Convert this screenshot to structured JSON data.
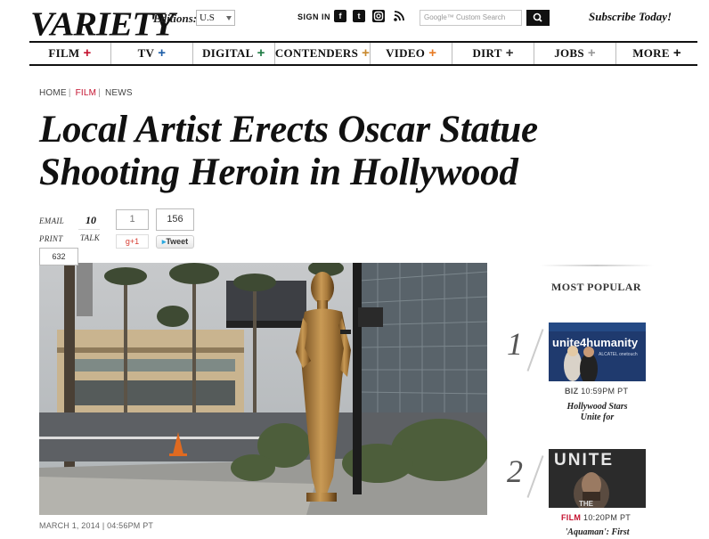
{
  "header": {
    "logo": "VARIETY",
    "editions_label": "Editions:",
    "edition_value": "U.S",
    "signin": "SIGN IN",
    "social": [
      "f",
      "t",
      "ig",
      "rss"
    ],
    "search_placeholder": "Google™ Custom Search",
    "subscribe": "Subscribe Today!"
  },
  "nav": [
    {
      "label": "FILM",
      "plus_color": "#c4122f"
    },
    {
      "label": "TV",
      "plus_color": "#1f5fa8"
    },
    {
      "label": "DIGITAL",
      "plus_color": "#1e7b43"
    },
    {
      "label": "CONTENDERS",
      "plus_color": "#c8892e"
    },
    {
      "label": "VIDEO",
      "plus_color": "#e77b25"
    },
    {
      "label": "DIRT",
      "plus_color": "#333333"
    },
    {
      "label": "JOBS",
      "plus_color": "#999999"
    },
    {
      "label": "MORE",
      "plus_color": "#111111"
    }
  ],
  "breadcrumb": {
    "home": "HOME",
    "film": "FILM",
    "news": "NEWS"
  },
  "headline": {
    "line1": "Local Artist Erects Oscar Statue",
    "line2": "Shooting Heroin in Hollywood"
  },
  "share": {
    "email": "EMAIL",
    "print": "PRINT",
    "talk_count": "10",
    "talk": "TALK",
    "gplus_count": "1",
    "gplus_label": "g+1",
    "tweet_count": "156",
    "tweet_label": "Tweet",
    "fb_count": "632"
  },
  "article": {
    "dateline": "MARCH 1, 2014 | 04:56PM PT"
  },
  "most_popular": {
    "title": "MOST POPULAR",
    "items": [
      {
        "rank": "1",
        "category": "BIZ",
        "time": "10:59PM PT",
        "title1": "Hollywood Stars",
        "title2": "Unite for",
        "thumb_text": "unite4humanity",
        "thumb_sub": "ALCATEL onetouch",
        "cat_color": "#555555"
      },
      {
        "rank": "2",
        "category": "FILM",
        "time": "10:20PM PT",
        "title1": "'Aquaman': First",
        "title2": "",
        "thumb_text": "UNITE",
        "thumb_sub": "THE",
        "cat_color": "#c4122f"
      }
    ]
  }
}
